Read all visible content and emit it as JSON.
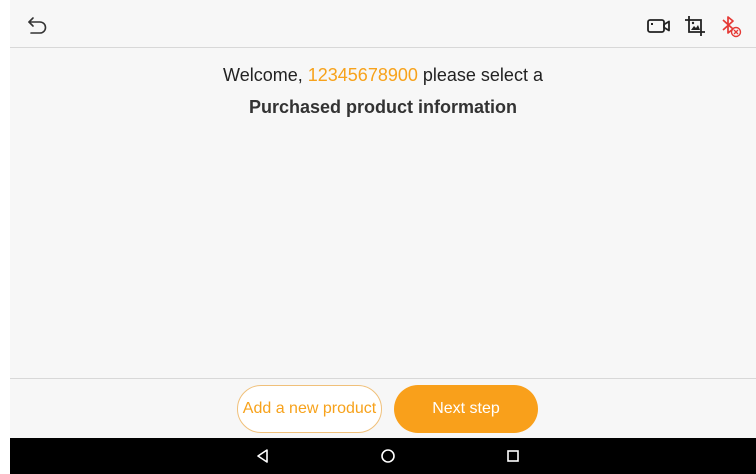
{
  "toolbar": {
    "back_icon": "back-arrow-icon",
    "icons": [
      "video-camera-icon",
      "image-crop-icon",
      "bluetooth-disconnected-icon"
    ],
    "bluetooth_color": "#e53935"
  },
  "main": {
    "welcome_prefix": "Welcome, ",
    "phone": "12345678900",
    "welcome_suffix": " please select a",
    "subtitle": "Purchased product information"
  },
  "footer": {
    "add_product_label": "Add a new product",
    "next_step_label": "Next step"
  },
  "navbar": {
    "icons": [
      "nav-back-icon",
      "nav-home-icon",
      "nav-recents-icon"
    ]
  },
  "colors": {
    "accent": "#f9a01b",
    "text": "#222222",
    "background": "#f7f7f7"
  }
}
